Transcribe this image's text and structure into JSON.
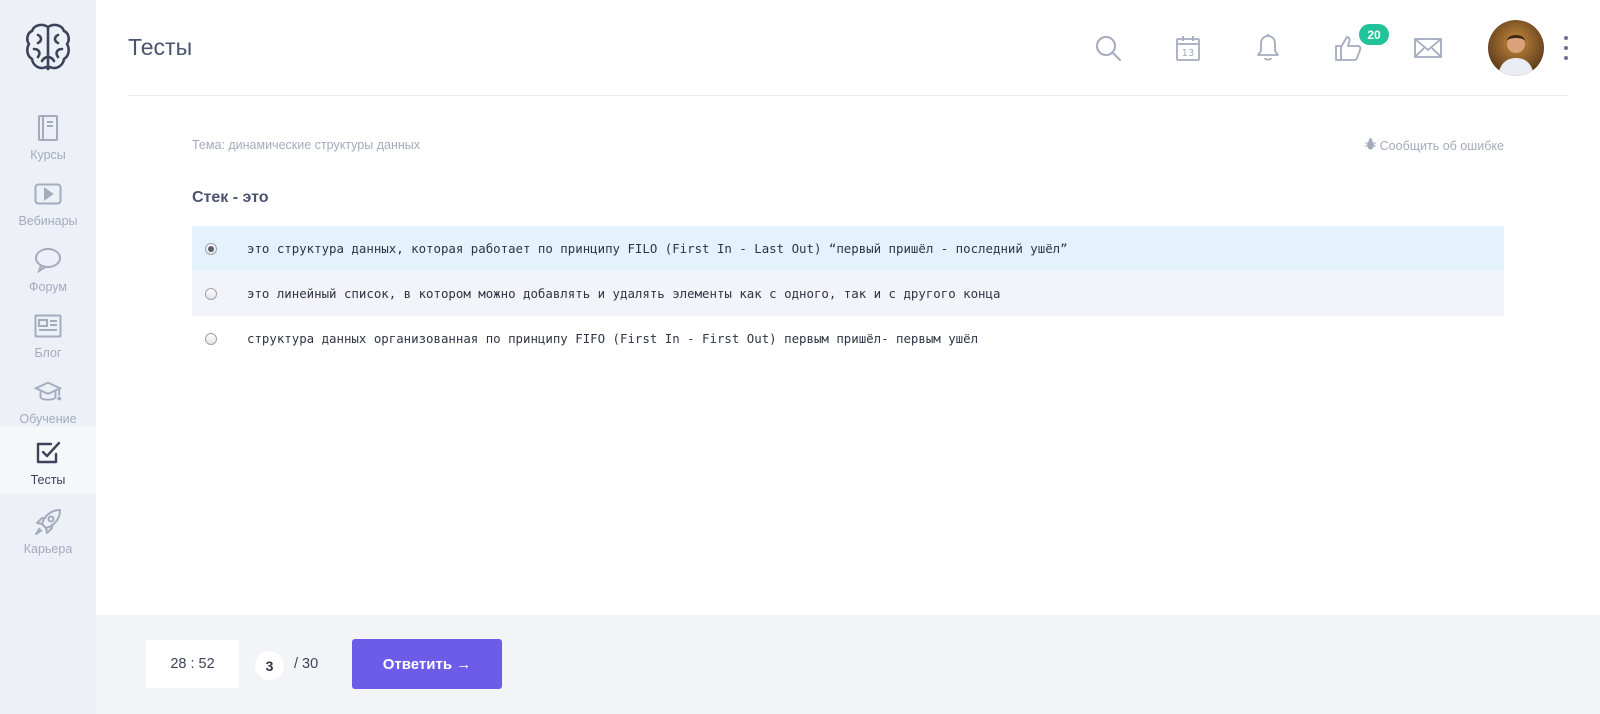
{
  "header": {
    "title": "Тесты",
    "notification_count": "20"
  },
  "sidebar": {
    "items": [
      {
        "label": "Курсы",
        "icon": "book-icon"
      },
      {
        "label": "Вебинары",
        "icon": "play-icon"
      },
      {
        "label": "Форум",
        "icon": "chat-bubble-icon"
      },
      {
        "label": "Блог",
        "icon": "newspaper-icon"
      },
      {
        "label": "Обучение",
        "icon": "graduation-cap-icon"
      },
      {
        "label": "Тесты",
        "icon": "checkbox-icon",
        "active": true
      },
      {
        "label": "Карьера",
        "icon": "rocket-icon"
      }
    ]
  },
  "toolbar": {
    "calendar_day": "13"
  },
  "test": {
    "topic": "Тема: динамические структуры данных",
    "report_label": "Сообщить об ошибке",
    "question": "Стек - это",
    "answers": [
      {
        "text": "это структура данных, которая работает по принципу FILO (First In - Last Out) “первый пришёл - последний ушёл”",
        "selected": true
      },
      {
        "text": "это линейный список, в котором можно добавлять и удалять элементы как с одного, так и с другого конца",
        "selected": false
      },
      {
        "text": "структура данных организованная по принципу FIFO (First In - First Out) первым пришёл- первым ушёл",
        "selected": false
      }
    ]
  },
  "footer": {
    "timer": "28 : 52",
    "current_question": "3",
    "total_questions": "/ 30",
    "submit_label": "Ответить →"
  },
  "colors": {
    "accent": "#6c5ce7",
    "badge": "#22c39a",
    "selected_row": "#e4f2fb",
    "sidebar_bg": "#edf0f7"
  }
}
